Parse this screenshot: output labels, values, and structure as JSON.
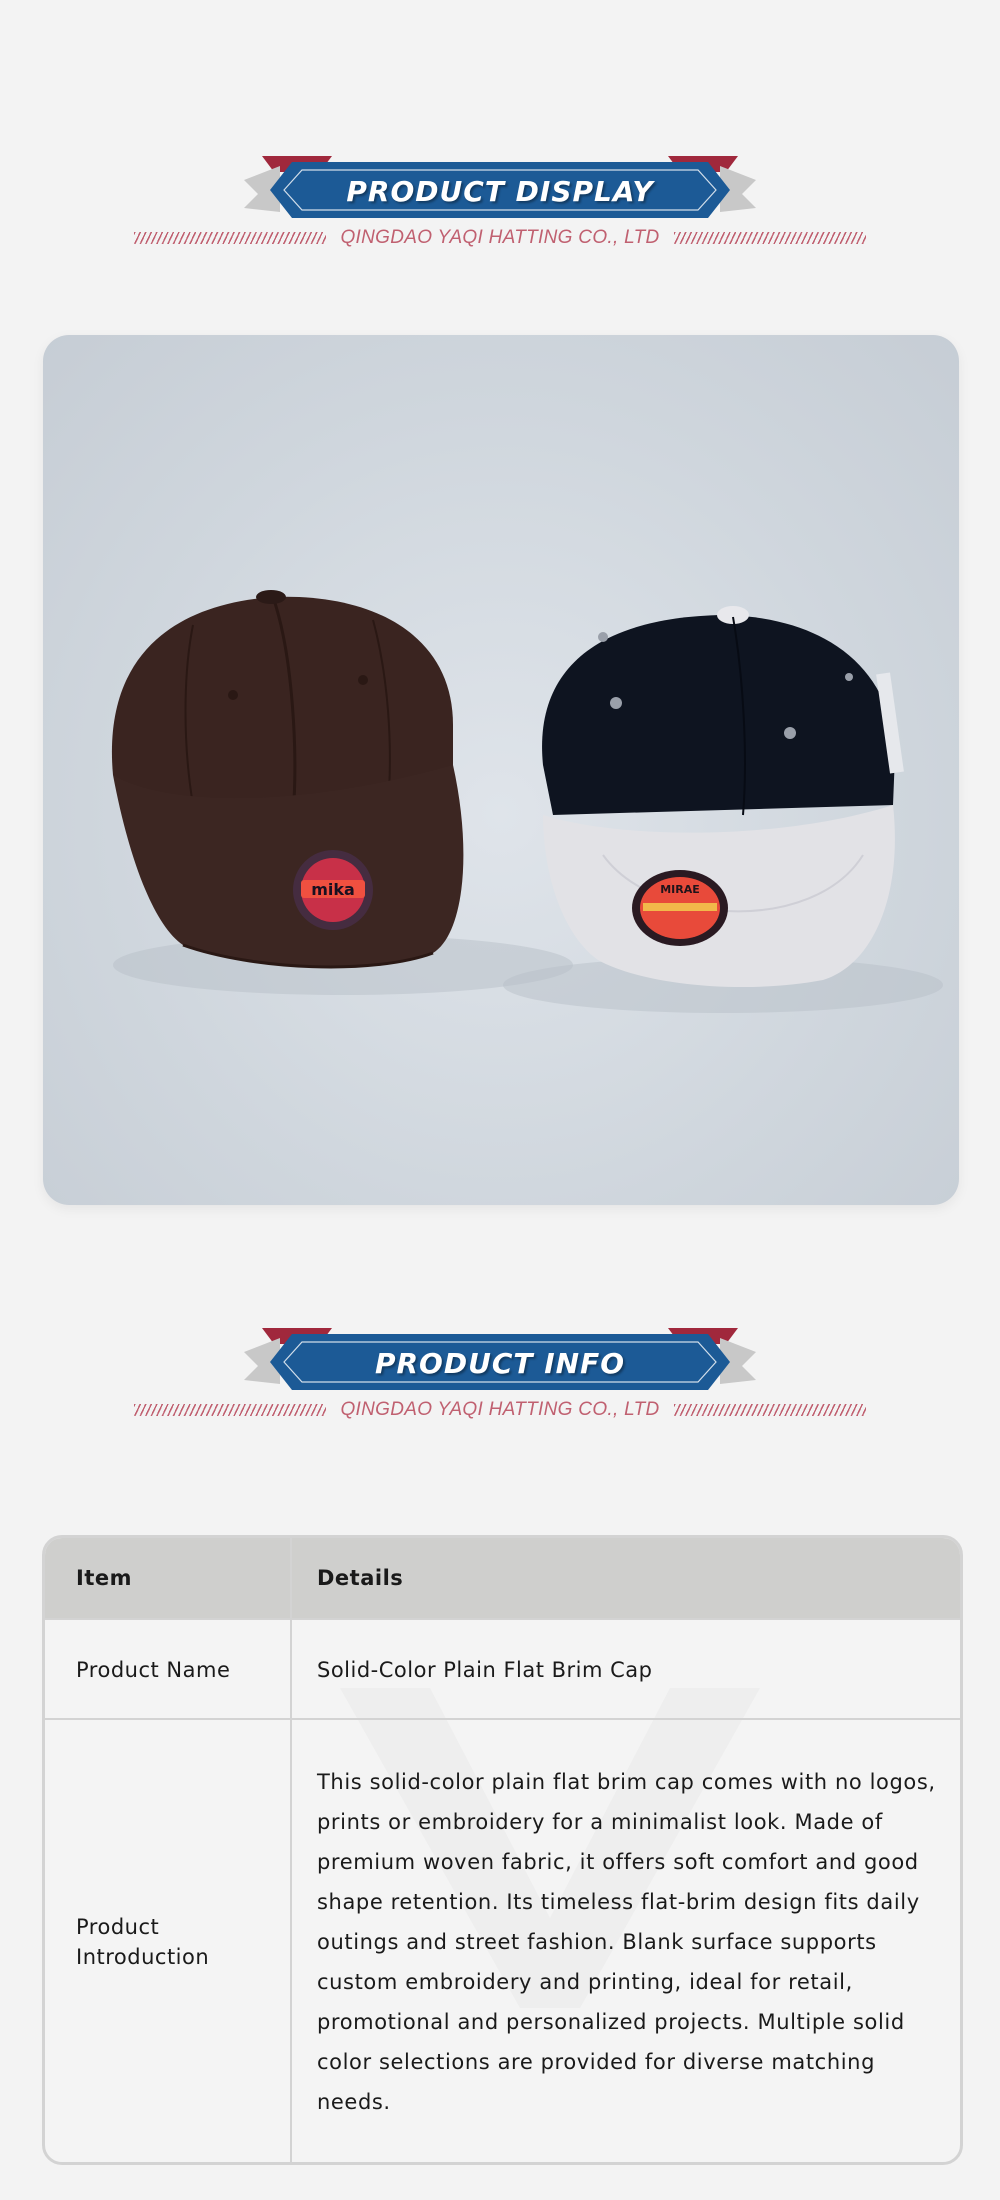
{
  "sections": {
    "display": {
      "title": "PRODUCT DISPLAY",
      "subtitle": "QINGDAO YAQI HATTING CO., LTD"
    },
    "info": {
      "title": "PRODUCT INFO",
      "subtitle": "QINGDAO YAQI HATTING CO., LTD"
    }
  },
  "product_image": {
    "left_cap": {
      "color": "#3a2420",
      "badge_text": "mika"
    },
    "right_cap": {
      "crown_color": "#0e1420",
      "brim_color": "#e2e2e6",
      "badge_text": "MIRAE"
    }
  },
  "table": {
    "headers": {
      "item": "Item",
      "details": "Details"
    },
    "rows": [
      {
        "item": "Product Name",
        "details": "Solid-Color Plain Flat Brim Cap"
      },
      {
        "item": "Product Introduction",
        "details": "This solid-color plain flat brim cap comes with no logos, prints or embroidery for a minimalist look. Made of premium woven fabric, it offers soft comfort and good shape retention. Its timeless flat-brim design fits daily outings and street fashion. Blank surface supports custom embroidery and printing, ideal for retail, promotional and personalized projects. Multiple solid color selections are provided for diverse matching needs."
      }
    ]
  },
  "colors": {
    "banner_blue": "#1c5a96",
    "banner_red": "#a0283c",
    "banner_gray": "#c8c8c8",
    "accent_pink": "#c06070",
    "header_bg": "#cfcfcd"
  }
}
